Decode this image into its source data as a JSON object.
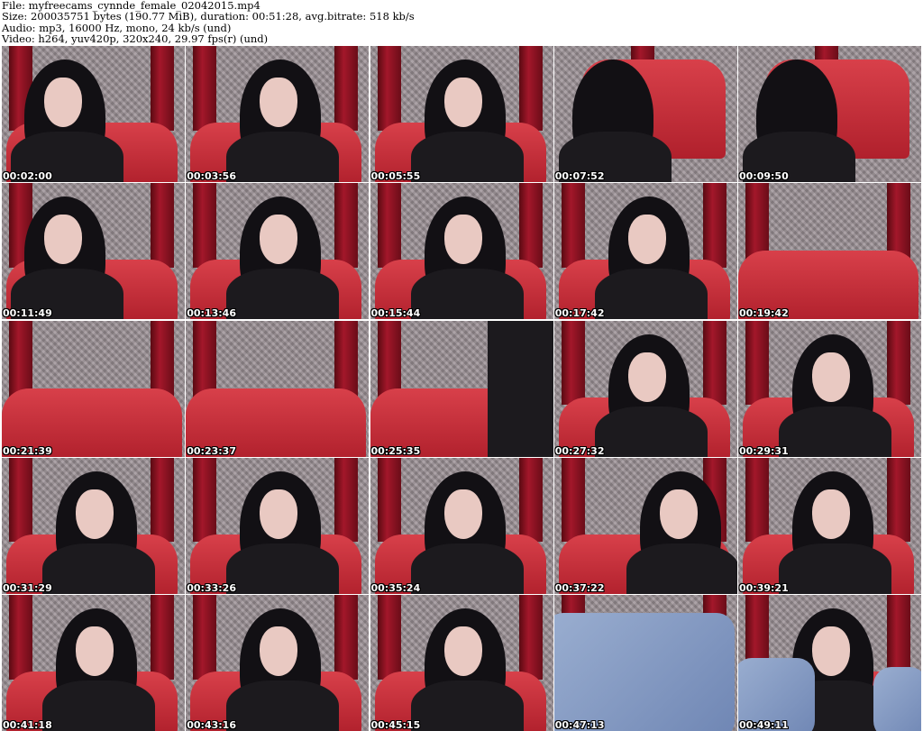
{
  "header": {
    "file_line": "File: myfreecams_cynnde_female_02042015.mp4",
    "size_line": "Size: 200035751 bytes (190.77 MiB), duration: 00:51:28, avg.bitrate: 518 kb/s",
    "audio_line": "Audio: mp3, 16000 Hz, mono, 24 kb/s (und)",
    "video_line": "Video: h264, yuv420p, 320x240, 29.97 fps(r) (und)"
  },
  "thumbnails": [
    {
      "timestamp": "00:02:00",
      "scene": "person-left-dark"
    },
    {
      "timestamp": "00:03:56",
      "scene": "person-center"
    },
    {
      "timestamp": "00:05:55",
      "scene": "person-center"
    },
    {
      "timestamp": "00:07:52",
      "scene": "closeup-arm"
    },
    {
      "timestamp": "00:09:50",
      "scene": "closeup-arm"
    },
    {
      "timestamp": "00:11:49",
      "scene": "person-left"
    },
    {
      "timestamp": "00:13:46",
      "scene": "person-center"
    },
    {
      "timestamp": "00:15:44",
      "scene": "person-center"
    },
    {
      "timestamp": "00:17:42",
      "scene": "person-center"
    },
    {
      "timestamp": "00:19:42",
      "scene": "empty-couch"
    },
    {
      "timestamp": "00:21:39",
      "scene": "empty-couch"
    },
    {
      "timestamp": "00:23:37",
      "scene": "empty-couch"
    },
    {
      "timestamp": "00:25:35",
      "scene": "empty-couch-dark"
    },
    {
      "timestamp": "00:27:32",
      "scene": "person-center"
    },
    {
      "timestamp": "00:29:31",
      "scene": "person-center"
    },
    {
      "timestamp": "00:31:29",
      "scene": "person-center"
    },
    {
      "timestamp": "00:33:26",
      "scene": "person-center"
    },
    {
      "timestamp": "00:35:24",
      "scene": "person-center"
    },
    {
      "timestamp": "00:37:22",
      "scene": "person-right"
    },
    {
      "timestamp": "00:39:21",
      "scene": "person-center"
    },
    {
      "timestamp": "00:41:18",
      "scene": "person-center"
    },
    {
      "timestamp": "00:43:16",
      "scene": "person-center"
    },
    {
      "timestamp": "00:45:15",
      "scene": "person-center"
    },
    {
      "timestamp": "00:47:13",
      "scene": "jeans-closeup"
    },
    {
      "timestamp": "00:49:11",
      "scene": "person-jeans"
    }
  ],
  "colors": {
    "curtain": "#a3172a",
    "couch": "#c8303c",
    "wall": "#9b9095",
    "hair": "#121014",
    "timestamp_text": "#ffffff"
  }
}
